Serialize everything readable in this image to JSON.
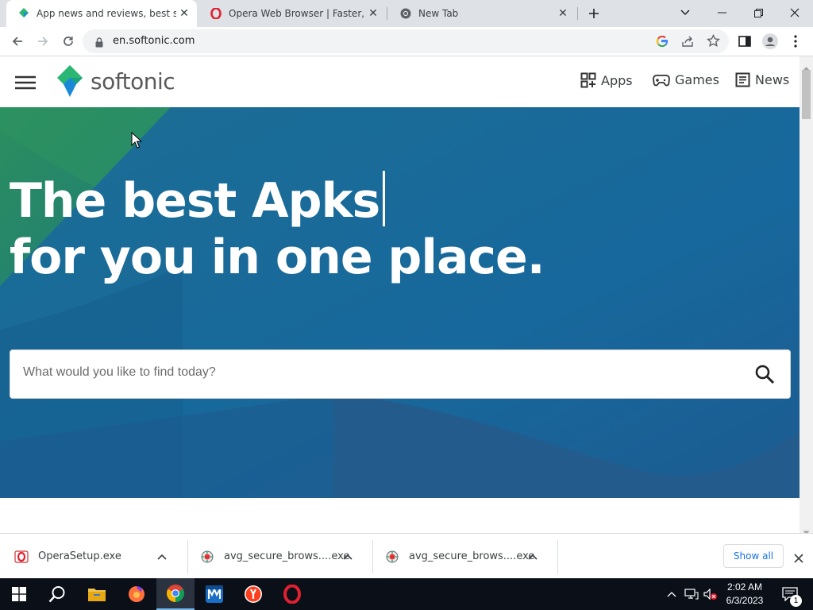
{
  "browser": {
    "tabs": [
      {
        "title": "App news and reviews, best softw",
        "active": true
      },
      {
        "title": "Opera Web Browser | Faster, Safer",
        "active": false
      },
      {
        "title": "New Tab",
        "active": false
      }
    ],
    "url": "en.softonic.com"
  },
  "site": {
    "logo_text": "softonic",
    "nav": [
      {
        "label": "Apps",
        "icon": "apps-grid-icon"
      },
      {
        "label": "Games",
        "icon": "gamepad-icon"
      },
      {
        "label": "News",
        "icon": "newspaper-icon"
      }
    ],
    "hero": {
      "line1": "The best Apks",
      "line2": "for you in one place."
    },
    "search": {
      "placeholder": "What would you like to find today?"
    }
  },
  "downloads": {
    "items": [
      {
        "name": "OperaSetup.exe"
      },
      {
        "name": "avg_secure_brows....exe"
      },
      {
        "name": "avg_secure_brows....exe"
      }
    ],
    "show_all": "Show all"
  },
  "taskbar": {
    "time": "2:02 AM",
    "date": "6/3/2023",
    "notification_count": "1"
  },
  "colors": {
    "hero_blue": "#1a6c9b",
    "hero_green": "#2e8a5c",
    "logo_green": "#2bb673",
    "logo_blue": "#1a8ad8"
  }
}
